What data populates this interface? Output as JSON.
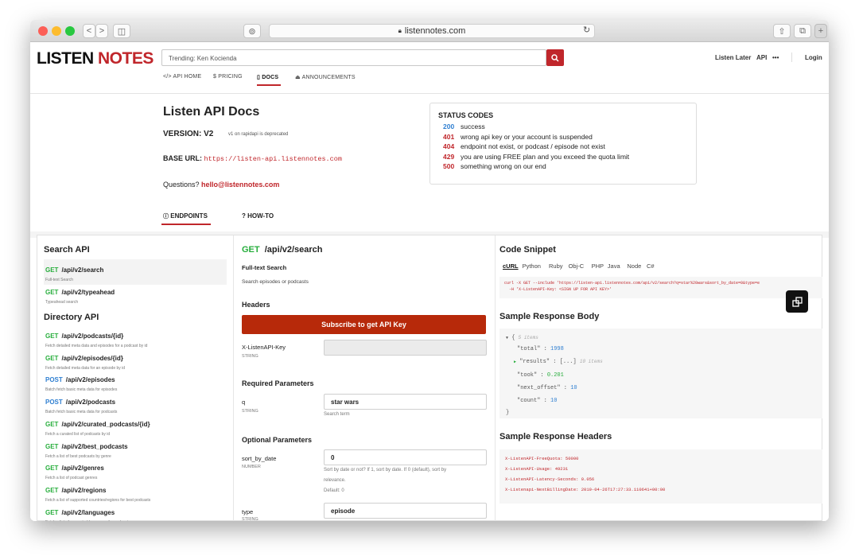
{
  "browser": {
    "url": "listennotes.com",
    "buttons": {
      "back": "<",
      "forward": ">",
      "sidebar": "◫",
      "shield": "⊚",
      "reload": "↻",
      "share": "⇧",
      "tabs": "⧉",
      "newtab": "+"
    }
  },
  "header": {
    "logo_a": "LISTEN",
    "logo_b": "NOTES",
    "search_placeholder": "Trending: Ken Kocienda",
    "nav": {
      "listen_later": "Listen Later",
      "api": "API",
      "more": "•••",
      "login": "Login"
    },
    "subnav": [
      "</> API HOME",
      "$ PRICING",
      "▯ DOCS",
      "⏏ ANNOUNCEMENTS"
    ]
  },
  "docs": {
    "title": "Listen API Docs",
    "version_label": "VERSION: V2",
    "deprecated": "v1 on rapidapi is deprecated",
    "base_url_label": "BASE URL:",
    "base_url": "https://listen-api.listennotes.com",
    "questions_label": "Questions?",
    "email": "hello@listennotes.com"
  },
  "status": {
    "title": "STATUS CODES",
    "codes": [
      {
        "code": "200",
        "text": "success",
        "color": "#2f7fd1"
      },
      {
        "code": "401",
        "text": "wrong api key or your account is suspended",
        "color": "#c0262b"
      },
      {
        "code": "404",
        "text": "endpoint not exist, or podcast / episode not exist",
        "color": "#c0262b"
      },
      {
        "code": "429",
        "text": "you are using FREE plan and you exceed the quota limit",
        "color": "#c0262b"
      },
      {
        "code": "500",
        "text": "something wrong on our end",
        "color": "#c0262b"
      }
    ]
  },
  "tabs": {
    "endpoints": "ENDPOINTS",
    "howto": "? HOW-TO"
  },
  "left": {
    "search_api": "Search API",
    "directory_api": "Directory API",
    "search_endpoints": [
      {
        "method": "GET",
        "path": "/api/v2/search",
        "desc": "Full-text Search"
      },
      {
        "method": "GET",
        "path": "/api/v2/typeahead",
        "desc": "Typeahead search"
      }
    ],
    "directory_endpoints": [
      {
        "method": "GET",
        "path": "/api/v2/podcasts/{id}",
        "desc": "Fetch detailed meta data and episodes for a podcast by id"
      },
      {
        "method": "GET",
        "path": "/api/v2/episodes/{id}",
        "desc": "Fetch detailed meta data for an episode by id"
      },
      {
        "method": "POST",
        "path": "/api/v2/episodes",
        "desc": "Batch fetch basic meta data for episodes"
      },
      {
        "method": "POST",
        "path": "/api/v2/podcasts",
        "desc": "Batch fetch basic meta data for podcasts"
      },
      {
        "method": "GET",
        "path": "/api/v2/curated_podcasts/{id}",
        "desc": "Fetch a curated list of podcasts by id"
      },
      {
        "method": "GET",
        "path": "/api/v2/best_podcasts",
        "desc": "Fetch a list of best podcasts by genre"
      },
      {
        "method": "GET",
        "path": "/api/v2/genres",
        "desc": "Fetch a list of podcast genres"
      },
      {
        "method": "GET",
        "path": "/api/v2/regions",
        "desc": "Fetch a list of supported countries/regions for best podcasts"
      },
      {
        "method": "GET",
        "path": "/api/v2/languages",
        "desc": "Fetch a list of supported languages for podcasts"
      }
    ]
  },
  "center": {
    "method": "GET",
    "path": "/api/v2/search",
    "subtitle": "Full-text Search",
    "desc": "Search episodes or podcasts",
    "headers": "Headers",
    "subscribe": "Subscribe to get API Key",
    "key_label": "X-ListenAPI-Key",
    "key_type": "STRING",
    "required": "Required Parameters",
    "q_label": "q",
    "q_type": "STRING",
    "q_value": "star wars",
    "q_help": "Search term",
    "optional": "Optional Parameters",
    "sort_label": "sort_by_date",
    "sort_type": "NUMBER",
    "sort_value": "0",
    "sort_help1": "Sort by date or not? If 1, sort by date. If 0 (default), sort by",
    "sort_help2": "relevance.",
    "sort_default": "Default: 0",
    "type_label": "type",
    "type_type": "STRING",
    "type_value": "episode"
  },
  "right": {
    "snippet_title": "Code Snippet",
    "langs": [
      "cURL",
      "Python",
      "Ruby",
      "Obj-C",
      "PHP",
      "Java",
      "Node",
      "C#"
    ],
    "curl_line1": "curl -X GET --include 'https://listen-api.listennotes.com/api/v2/search?q=star%20wars&sort_by_date=0&type=e",
    "curl_line2": "  -H 'X-ListenAPI-Key: <SIGN UP FOR API KEY>'",
    "body_title": "Sample Response Body",
    "json": {
      "open": "{",
      "items": "5 items",
      "total_k": "\"total\"",
      "total_v": "1998",
      "results_k": "\"results\"",
      "results_v": "[...]",
      "results_n": "10 items",
      "took_k": "\"took\"",
      "took_v": "0.201",
      "next_k": "\"next_offset\"",
      "next_v": "10",
      "count_k": "\"count\"",
      "count_v": "10",
      "close": "}"
    },
    "headers_title": "Sample Response Headers",
    "resp_headers": [
      "X-ListenAPI-FreeQuota: 50000",
      "X-ListenAPI-Usage: 49231",
      "X-ListenAPI-Latency-Seconds: 0.056",
      "X-Listenapi-NextBillingDate: 2019-04-26T17:27:33.110641+00:00"
    ]
  },
  "colors": {
    "brand_red": "#c0262b",
    "get_green": "#27ae3c",
    "post_blue": "#2f7fd1",
    "subscribe": "#b7290a"
  }
}
